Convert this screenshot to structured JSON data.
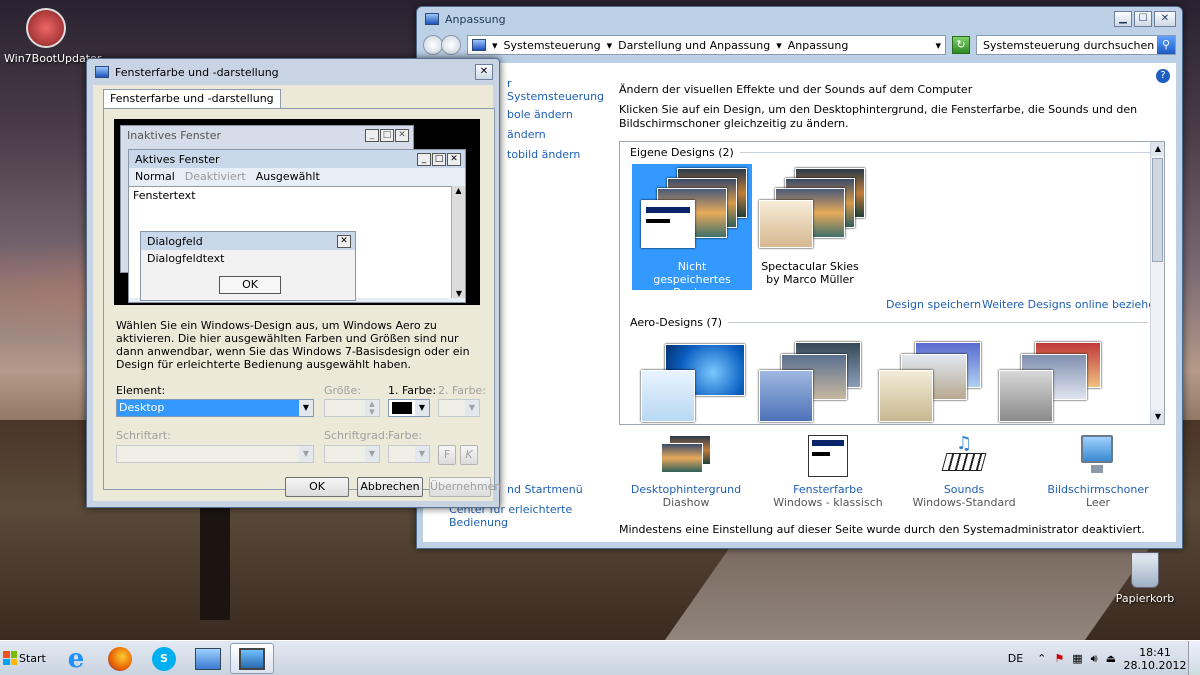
{
  "desktop": {
    "icons": [
      {
        "label": "Win7BootUpdater"
      },
      {
        "label": "Papierkorb"
      }
    ]
  },
  "anpassung": {
    "title": "Anpassung",
    "breadcrumb": [
      "Systemsteuerung",
      "Darstellung und Anpassung",
      "Anpassung"
    ],
    "search_placeholder": "Systemsteuerung durchsuchen",
    "left_links": [
      "r Systemsteuerung",
      "bole ändern",
      "ändern",
      "tobild ändern",
      "nd Startmenü",
      "Center für erleichterte",
      "Bedienung"
    ],
    "heading": "Ändern der visuellen Effekte und der Sounds auf dem Computer",
    "subheading": "Klicken Sie auf ein Design, um den Desktophintergrund, die Fensterfarbe, die Sounds und den Bildschirmschoner gleichzeitig zu ändern.",
    "groups": [
      {
        "name": "Eigene Designs (2)"
      },
      {
        "name": "Aero-Designs (7)"
      }
    ],
    "own_themes": [
      {
        "label": "Nicht gespeichertes Design",
        "selected": true
      },
      {
        "label": "Spectacular Skies by Marco Müller",
        "selected": false
      }
    ],
    "save_link": "Design speichern",
    "more_link": "Weitere Designs online beziehen",
    "bottom": [
      {
        "title": "Desktophintergrund",
        "sub": "Diashow",
        "icon": "desktop-background-icon"
      },
      {
        "title": "Fensterfarbe",
        "sub": "Windows - klassisch",
        "icon": "window-color-icon"
      },
      {
        "title": "Sounds",
        "sub": "Windows-Standard",
        "icon": "sounds-icon"
      },
      {
        "title": "Bildschirmschoner",
        "sub": "Leer",
        "icon": "screensaver-icon"
      }
    ],
    "notice": "Mindestens eine Einstellung auf dieser Seite wurde durch den Systemadministrator deaktiviert."
  },
  "dialog": {
    "title": "Fensterfarbe und -darstellung",
    "tab": "Fensterfarbe und -darstellung",
    "preview": {
      "inactive": "Inaktives Fenster",
      "active": "Aktives Fenster",
      "menu": [
        "Normal",
        "Deaktiviert",
        "Ausgewählt"
      ],
      "window_text": "Fenstertext",
      "msgbox_title": "Dialogfeld",
      "msgbox_text": "Dialogfeldtext",
      "ok": "OK"
    },
    "description": "Wählen Sie ein Windows-Design aus, um Windows Aero zu aktivieren. Die hier ausgewählten Farben und Größen sind nur dann anwendbar, wenn Sie das Windows 7-Basisdesign oder ein Design für erleichterte Bedienung ausgewählt haben.",
    "labels": {
      "element": "Element:",
      "size": "Größe:",
      "color1": "1. Farbe:",
      "color2": "2. Farbe:",
      "font": "Schriftart:",
      "fontsize": "Schriftgrad:",
      "fontcolor": "Farbe:",
      "bold": "F",
      "italic": "K"
    },
    "element_value": "Desktop",
    "buttons": {
      "ok": "OK",
      "cancel": "Abbrechen",
      "apply": "Übernehmen"
    }
  },
  "taskbar": {
    "start": "Start",
    "lang": "DE",
    "time": "18:41",
    "date": "28.10.2012"
  }
}
